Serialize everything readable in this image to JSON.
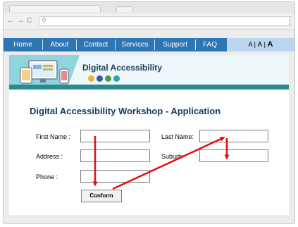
{
  "nav": {
    "items": [
      {
        "label": "Home"
      },
      {
        "label": "About"
      },
      {
        "label": "Contact"
      },
      {
        "label": "Services"
      },
      {
        "label": "Support"
      },
      {
        "label": "FAQ"
      }
    ],
    "font_size_small": "A",
    "font_size_sep1": "|",
    "font_size_medium": "A",
    "font_size_sep2": "|",
    "font_size_large": "A"
  },
  "banner": {
    "title": "Digital Accessibility",
    "icons": [
      "eye-icon",
      "hearing-icon",
      "wheelchair-icon",
      "brain-icon"
    ]
  },
  "form": {
    "title": "Digital Accessibility Workshop - Application",
    "first_name_label": "First Name  :",
    "last_name_label": "Last Name:",
    "address_label": "Address :",
    "suburb_label": "Suburb:",
    "phone_label": "Phone :",
    "submit_label": "Conform"
  },
  "colors": {
    "nav_bg": "#2e75b6",
    "font_bar_bg": "#bcd5ee",
    "banner_band": "#2a8a8e",
    "title_color": "#17375e",
    "arrow_color": "#e01010"
  }
}
